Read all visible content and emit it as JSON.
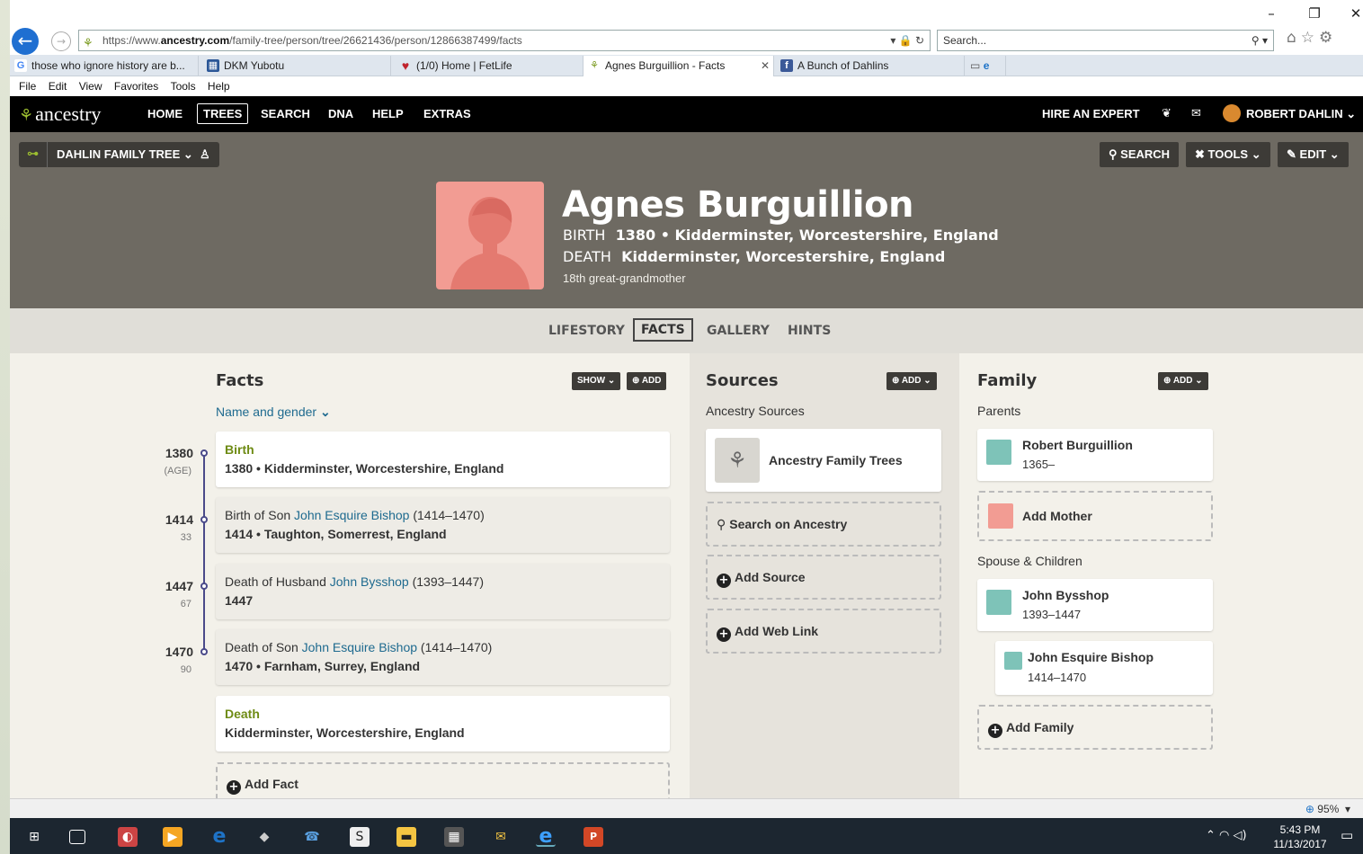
{
  "browser": {
    "url_prefix": "https://www.",
    "url_domain": "ancestry.com",
    "url_path": "/family-tree/person/tree/26621436/person/12866387499/facts",
    "search_placeholder": "Search...",
    "tabs": [
      {
        "label": "those who ignore history are b..."
      },
      {
        "label": "DKM Yubotu"
      },
      {
        "label": "(1/0) Home | FetLife"
      },
      {
        "label": "Agnes Burguillion - Facts"
      },
      {
        "label": "A Bunch of Dahlins"
      }
    ],
    "menu": [
      "File",
      "Edit",
      "View",
      "Favorites",
      "Tools",
      "Help"
    ],
    "zoom": "95%"
  },
  "nav": {
    "logo": "ancestry",
    "items": [
      "HOME",
      "TREES",
      "SEARCH",
      "DNA",
      "HELP",
      "EXTRAS"
    ],
    "hire": "HIRE AN EXPERT",
    "user": "ROBERT DAHLIN"
  },
  "tree": {
    "name": "DAHLIN FAMILY TREE",
    "search": "SEARCH",
    "tools": "TOOLS",
    "edit": "EDIT"
  },
  "person": {
    "name": "Agnes Burguillion",
    "birth_key": "BIRTH",
    "birth_val": "1380 • Kidderminster, Worcestershire, England",
    "death_key": "DEATH",
    "death_val": "Kidderminster, Worcestershire, England",
    "relation": "18th great-grandmother"
  },
  "subnav": [
    "LIFESTORY",
    "FACTS",
    "GALLERY",
    "HINTS"
  ],
  "facts": {
    "title": "Facts",
    "show": "SHOW",
    "add": "ADD",
    "name_gender": "Name and gender",
    "items": [
      {
        "year": "1380",
        "age": "(AGE)",
        "event": "Birth",
        "detail": "1380 • Kidderminster, Worcestershire, England"
      },
      {
        "year": "1414",
        "age": "33",
        "prefix": "Birth of Son ",
        "person": "John Esquire Bishop",
        "span": " (1414–1470)",
        "detail": "1414 • Taughton, Somerrest, England"
      },
      {
        "year": "1447",
        "age": "67",
        "prefix": "Death of Husband ",
        "person": "John Bysshop",
        "span": " (1393–1447)",
        "detail": "1447"
      },
      {
        "year": "1470",
        "age": "90",
        "prefix": "Death of Son ",
        "person": "John Esquire Bishop",
        "span": " (1414–1470)",
        "detail": "1470 • Farnham, Surrey, England"
      },
      {
        "event": "Death",
        "detail": "Kidderminster, Worcestershire, England"
      }
    ],
    "add_fact": "Add Fact"
  },
  "sources": {
    "title": "Sources",
    "add": "ADD",
    "subtitle": "Ancestry Sources",
    "tree_source": "Ancestry Family Trees",
    "search": "Search on Ancestry",
    "add_source": "Add Source",
    "add_web": "Add Web Link"
  },
  "family": {
    "title": "Family",
    "add": "ADD",
    "parents": "Parents",
    "father_name": "Robert Burguillion",
    "father_dates": "1365–",
    "add_mother": "Add Mother",
    "spouse_children": "Spouse & Children",
    "spouse_name": "John Bysshop",
    "spouse_dates": "1393–1447",
    "child_name": "John Esquire Bishop",
    "child_dates": "1414–1470",
    "add_family": "Add Family"
  },
  "clock": {
    "time": "5:43 PM",
    "date": "11/13/2017"
  },
  "colors": {
    "accent_green": "#9cbe30",
    "header_bg": "#6e6a62",
    "female_avatar": "#f29c93",
    "male_avatar": "#7ec3b8",
    "link": "#1e6a8f"
  }
}
